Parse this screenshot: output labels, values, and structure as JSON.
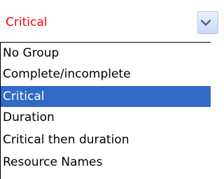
{
  "combo": {
    "value": "Critical",
    "value_color": "#ff0000",
    "button_icon": "chevron-down-icon"
  },
  "dropdown": {
    "selected_index": 2,
    "highlight_color": "#316ac5",
    "options": [
      {
        "label": "No Group"
      },
      {
        "label": "Complete/incomplete"
      },
      {
        "label": "Critical"
      },
      {
        "label": "Duration"
      },
      {
        "label": "Critical then duration"
      },
      {
        "label": "Resource Names"
      }
    ]
  }
}
